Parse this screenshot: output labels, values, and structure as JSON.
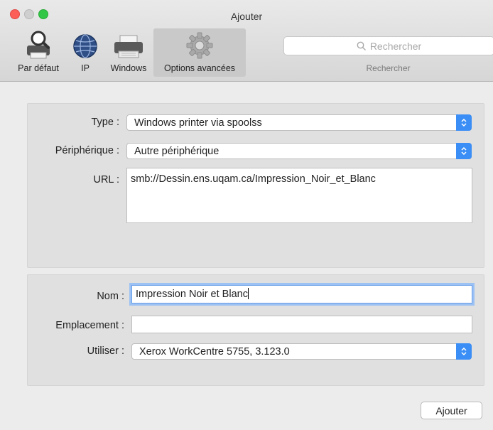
{
  "window": {
    "title": "Ajouter"
  },
  "toolbar": {
    "items": [
      {
        "label": "Par défaut",
        "icon": "default-printer-icon",
        "selected": false
      },
      {
        "label": "IP",
        "icon": "globe-icon",
        "selected": false
      },
      {
        "label": "Windows",
        "icon": "printer-icon",
        "selected": false
      },
      {
        "label": "Options avancées",
        "icon": "gear-icon",
        "selected": true
      }
    ],
    "search": {
      "placeholder": "Rechercher",
      "caption": "Rechercher"
    }
  },
  "connection": {
    "type_label": "Type :",
    "type_value": "Windows printer via spoolss",
    "device_label": "Périphérique :",
    "device_value": "Autre périphérique",
    "url_label": "URL :",
    "url_value": "smb://Dessin.ens.uqam.ca/Impression_Noir_et_Blanc"
  },
  "details": {
    "name_label": "Nom :",
    "name_value": "Impression Noir et Blanc",
    "location_label": "Emplacement :",
    "location_value": "",
    "use_label": "Utiliser :",
    "use_value": "Xerox WorkCentre 5755, 3.123.0"
  },
  "actions": {
    "add_label": "Ajouter"
  },
  "colors": {
    "accent": "#3a8ef5",
    "focus_ring": "#9cc2f4"
  }
}
